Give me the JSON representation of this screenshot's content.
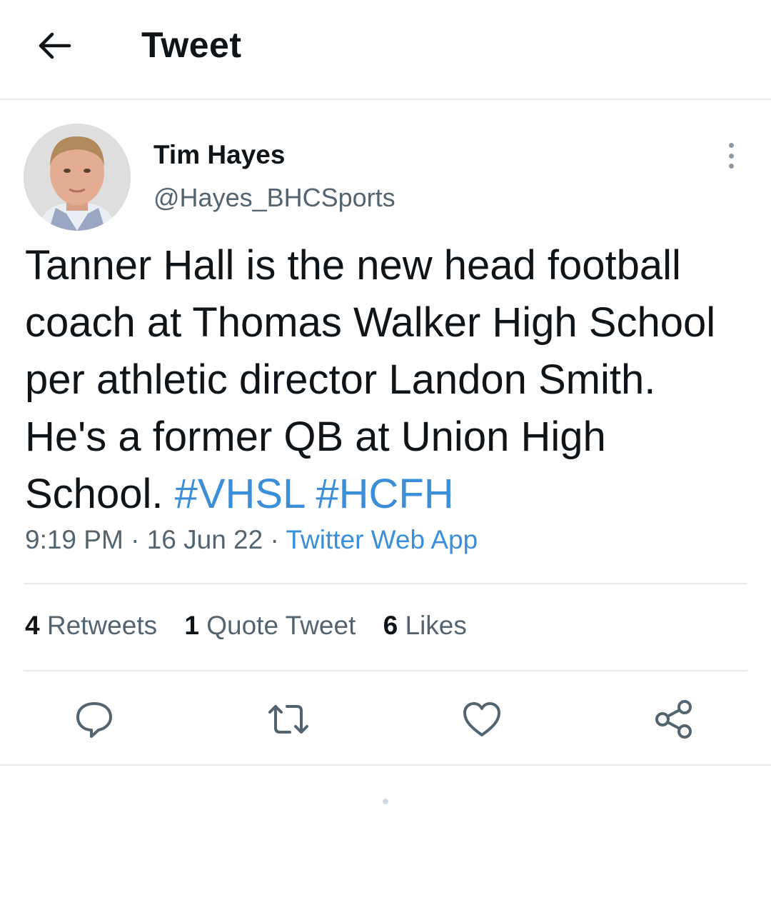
{
  "header": {
    "title": "Tweet",
    "back_icon": "arrow-left-icon"
  },
  "author": {
    "name": "Tim Hayes",
    "handle": "@Hayes_BHCSports"
  },
  "tweet": {
    "line1": "Tanner Hall is the new head football",
    "line2": "coach at Thomas Walker High School",
    "line3": "per athletic director Landon Smith.",
    "line4": "He's a former QB at Union High",
    "line5_text": "School.",
    "hashtags": [
      "#VHSL",
      "#HCFH"
    ]
  },
  "meta": {
    "time": "9:19 PM",
    "sep1": " · ",
    "date": "16 Jun 22",
    "sep2": " · ",
    "source": "Twitter Web App"
  },
  "stats": {
    "retweets_count": "4",
    "retweets_label": "Retweets",
    "quotes_count": "1",
    "quotes_label": "Quote Tweet",
    "likes_count": "6",
    "likes_label": "Likes"
  },
  "actions": [
    "reply-icon",
    "retweet-icon",
    "like-icon",
    "share-icon"
  ],
  "colors": {
    "link": "#3b8fd9",
    "secondary_text": "#536471",
    "primary_text": "#0f1419",
    "divider": "#e6e9eb"
  }
}
